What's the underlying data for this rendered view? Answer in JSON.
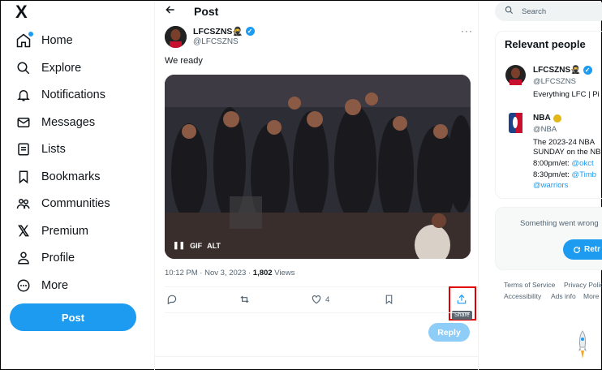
{
  "nav": {
    "items": [
      {
        "label": "Home",
        "icon": "home-icon"
      },
      {
        "label": "Explore",
        "icon": "search-icon"
      },
      {
        "label": "Notifications",
        "icon": "bell-icon"
      },
      {
        "label": "Messages",
        "icon": "envelope-icon"
      },
      {
        "label": "Lists",
        "icon": "list-icon"
      },
      {
        "label": "Bookmarks",
        "icon": "bookmark-icon"
      },
      {
        "label": "Communities",
        "icon": "communities-icon"
      },
      {
        "label": "Premium",
        "icon": "x-logo-icon"
      },
      {
        "label": "Profile",
        "icon": "person-icon"
      },
      {
        "label": "More",
        "icon": "more-circle-icon"
      }
    ],
    "post_button": "Post",
    "logo": "X"
  },
  "header": {
    "title": "Post",
    "back_icon": "arrow-left-icon"
  },
  "tweet": {
    "author_name": "LFCSZNS🥷",
    "handle": "@LFCSZNS",
    "text": "We ready",
    "gif_label": "GIF",
    "alt_label": "ALT",
    "time": "10:12 PM · Nov 3, 2023 · ",
    "views_count": "1,802",
    "views_label": " Views",
    "likes": "4",
    "share_tooltip": "Share",
    "reply_button": "Reply"
  },
  "sidebar": {
    "search_placeholder": "Search",
    "relevant_title": "Relevant people",
    "people": [
      {
        "name": "LFCSZNS🥷",
        "handle": "@LFCSZNS",
        "bio_line1": "Everything LFC | Pi"
      },
      {
        "name": "NBA",
        "handle": "@NBA",
        "bio_line1": "The 2023-24 NBA",
        "bio_line2": "SUNDAY on the NB",
        "bio_line3_text": "8:00pm/et: ",
        "bio_line3_link": "@okct",
        "bio_line4_text": "8:30pm/et: ",
        "bio_line4_link": "@Timb",
        "bio_line5_link": "@warriors"
      }
    ],
    "error_text": "Something went wrong",
    "retry_label": "Retr",
    "footer": [
      "Terms of Service",
      "Privacy Polic",
      "Accessibility",
      "Ads info",
      "More"
    ]
  },
  "colors": {
    "accent": "#1d9bf0",
    "highlight_box": "#e10000"
  }
}
